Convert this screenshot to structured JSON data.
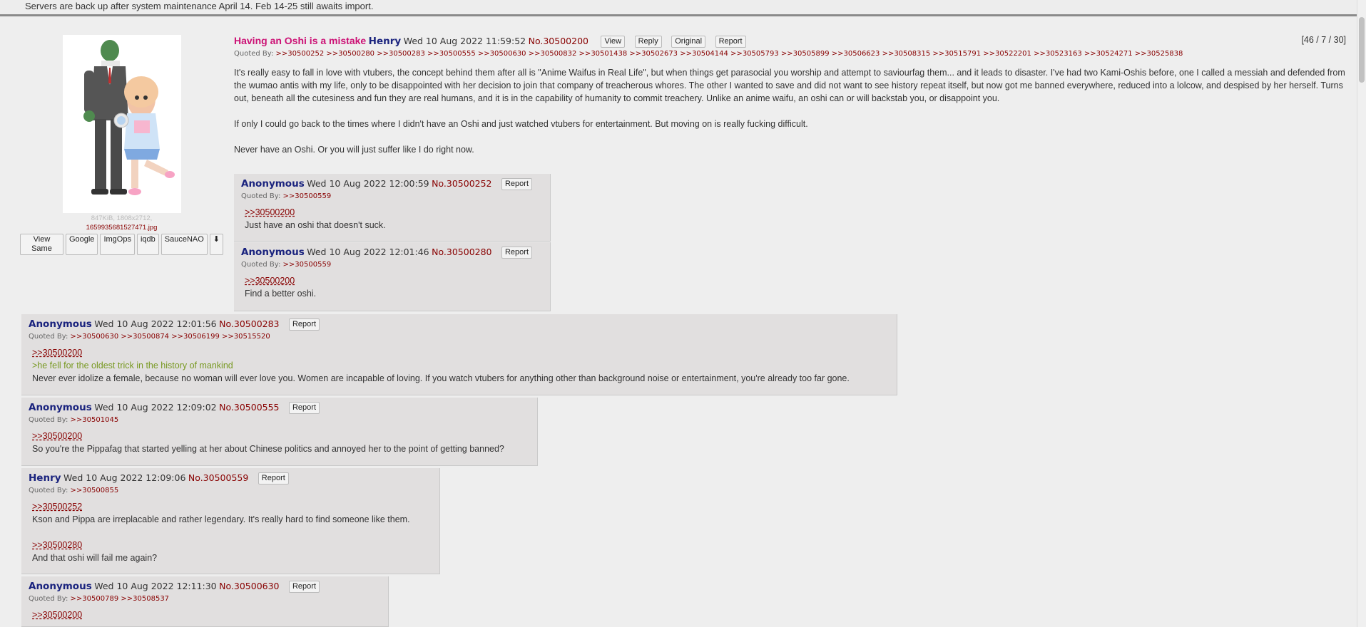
{
  "notice": "Servers are back up after system maintenance April 14. Feb 14-25 still awaits import.",
  "op": {
    "file_info": "847KiB, 1808x2712,",
    "file_name": "1659935681527471.jpg",
    "thumb_buttons": [
      "View Same",
      "Google",
      "ImgOps",
      "iqdb",
      "SauceNAO"
    ],
    "subject": "Having an Oshi is a mistake",
    "name": "Henry",
    "date": "Wed 10 Aug 2022 11:59:52",
    "no": "No.30500200",
    "buttons": [
      "View",
      "Reply",
      "Original",
      "Report"
    ],
    "counter": "[46 / 7 / 30]",
    "quoted_by_label": "Quoted By:",
    "quoted_by": ">>30500252 >>30500280 >>30500283 >>30500555 >>30500630 >>30500832 >>30501438 >>30502673 >>30504144 >>30505793 >>30505899 >>30506623 >>30508315 >>30515791 >>30522201 >>30523163 >>30524271 >>30525838",
    "paragraphs": [
      "It's really easy to fall in love with vtubers, the concept behind them after all is \"Anime Waifus in Real Life\", but when things get parasocial you worship and attempt to saviourfag them... and it leads to disaster. I've had two Kami-Oshis before, one I called a messiah and defended from the wumao antis with my life, only to be disappointed with her decision to join that company of treacherous whores. The other I wanted to save and did not want to see history repeat itself, but now got me banned everywhere, reduced into a lolcow, and despised by her herself. Turns out, beneath all the cutesiness and fun they are real humans, and it is in the capability of humanity to commit treachery. Unlike an anime waifu, an oshi can or will backstab you, or disappoint you.",
      "If only I could go back to the times where I didn't have an Oshi and just watched vtubers for entertainment. But moving on is really fucking difficult.",
      "Never have an Oshi. Or you will just suffer like I do right now."
    ]
  },
  "report_label": "Report",
  "replies": [
    {
      "name": "Anonymous",
      "date": "Wed 10 Aug 2022 12:00:59",
      "no": "No.30500252",
      "quoted_by": ">>30500559",
      "quote": ">>30500200",
      "greentext": "",
      "text": "Just have an oshi that doesn't suck.",
      "quote2": "",
      "text2": ""
    },
    {
      "name": "Anonymous",
      "date": "Wed 10 Aug 2022 12:01:46",
      "no": "No.30500280",
      "quoted_by": ">>30500559",
      "quote": ">>30500200",
      "greentext": "",
      "text": "Find a better oshi.",
      "quote2": "",
      "text2": ""
    },
    {
      "name": "Anonymous",
      "date": "Wed 10 Aug 2022 12:01:56",
      "no": "No.30500283",
      "quoted_by": ">>30500630 >>30500874 >>30506199 >>30515520",
      "quote": ">>30500200",
      "greentext": ">he fell for the oldest trick in the history of mankind",
      "text": "Never ever idolize a female, because no woman will ever love you. Women are incapable of loving. If you watch vtubers for anything other than background noise or entertainment, you're already too far gone.",
      "quote2": "",
      "text2": ""
    },
    {
      "name": "Anonymous",
      "date": "Wed 10 Aug 2022 12:09:02",
      "no": "No.30500555",
      "quoted_by": ">>30501045",
      "quote": ">>30500200",
      "greentext": "",
      "text": "So you're the Pippafag that started yelling at her about Chinese politics and annoyed her to the point of getting banned?",
      "quote2": "",
      "text2": ""
    },
    {
      "name": "Henry",
      "date": "Wed 10 Aug 2022 12:09:06",
      "no": "No.30500559",
      "quoted_by": ">>30500855",
      "quote": ">>30500252",
      "greentext": "",
      "text": "Kson and Pippa are irreplacable and rather legendary. It's really hard to find someone like them.",
      "quote2": ">>30500280",
      "text2": "And that oshi will fail me again?"
    },
    {
      "name": "Anonymous",
      "date": "Wed 10 Aug 2022 12:11:30",
      "no": "No.30500630",
      "quoted_by": ">>30500789 >>30508537",
      "quote": ">>30500200",
      "greentext": "",
      "text": "",
      "quote2": "",
      "text2": ""
    }
  ]
}
